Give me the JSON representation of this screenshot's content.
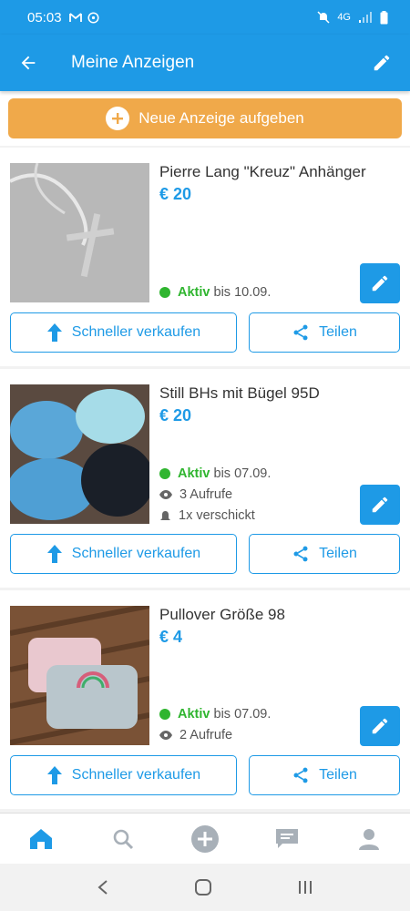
{
  "status": {
    "time": "05:03",
    "network": "4G"
  },
  "header": {
    "title": "Meine Anzeigen"
  },
  "new_ad": {
    "label": "Neue Anzeige aufgeben"
  },
  "ads": [
    {
      "title": "Pierre Lang \"Kreuz\" Anhänger",
      "price": "€ 20",
      "status": "Aktiv",
      "until": "bis 10.09.",
      "sell_label": "Schneller verkaufen",
      "share_label": "Teilen"
    },
    {
      "title": "Still BHs mit Bügel 95D",
      "price": "€ 20",
      "status": "Aktiv",
      "until": "bis 07.09.",
      "views": "3 Aufrufe",
      "sent": "1x verschickt",
      "sell_label": "Schneller verkaufen",
      "share_label": "Teilen"
    },
    {
      "title": "Pullover Größe 98",
      "price": "€ 4",
      "status": "Aktiv",
      "until": "bis 07.09.",
      "views": "2 Aufrufe",
      "sell_label": "Schneller verkaufen",
      "share_label": "Teilen"
    }
  ],
  "bottom_nav": [
    "home-icon",
    "search-icon",
    "add-icon",
    "messages-icon",
    "profile-icon"
  ],
  "colors": {
    "primary": "#1e9ae6",
    "accent": "#f0a94a",
    "active": "#2fb52f"
  }
}
